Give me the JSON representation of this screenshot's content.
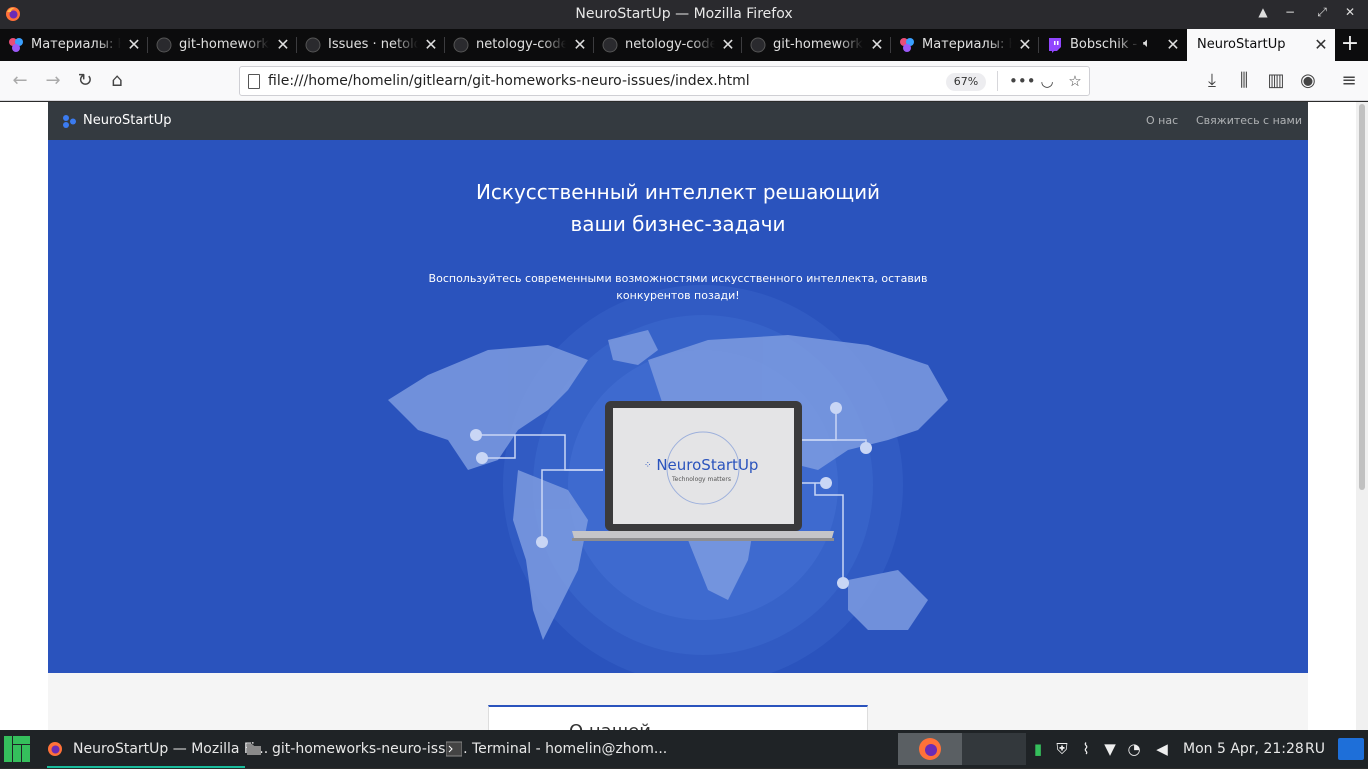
{
  "window": {
    "title": "NeuroStartUp — Mozilla Firefox"
  },
  "tabs": [
    {
      "label": "Материалы: Н",
      "icon": "netology-icon"
    },
    {
      "label": "git-homework",
      "icon": "github-icon"
    },
    {
      "label": "Issues · netolo",
      "icon": "github-icon"
    },
    {
      "label": "netology-code",
      "icon": "github-icon"
    },
    {
      "label": "netology-code",
      "icon": "github-icon"
    },
    {
      "label": "git-homework",
      "icon": "github-icon"
    },
    {
      "label": "Материалы: Н",
      "icon": "netology-icon"
    },
    {
      "label": "Bobschik -",
      "icon": "twitch-icon"
    },
    {
      "label": "NeuroStartUp",
      "icon": "none"
    }
  ],
  "toolbar": {
    "url": "file:///home/homelin/gitlearn/git-homeworks-neuro-issues/index.html",
    "zoom": "67%"
  },
  "site": {
    "brand": "NeuroStartUp",
    "nav": [
      "О нас",
      "Свяжитесь с нами"
    ],
    "hero_title_line1": "Искусственный интеллект решающий",
    "hero_title_line2": "ваши бизнес-задачи",
    "hero_lead_line1": "Воспользуйтесь современными возможностями искусственного интеллекта, оставив",
    "hero_lead_line2": "конкурентов позади!",
    "laptop_brand": "NeuroStartUp",
    "laptop_tagline": "Technology matters",
    "section_title": "О нашей"
  },
  "taskbar": {
    "items": [
      {
        "label": "NeuroStartUp — Mozilla Fi...",
        "icon": "firefox-icon"
      },
      {
        "label": "git-homeworks-neuro-issu...",
        "icon": "folder-icon"
      },
      {
        "label": "Terminal - homelin@zhom...",
        "icon": "terminal-icon"
      }
    ],
    "clock": "Mon  5 Apr, 21:28",
    "lang": "RU"
  },
  "colors": {
    "hero": "#2a53bd",
    "site_nav": "#343a40",
    "accent": "#1abc9c"
  }
}
